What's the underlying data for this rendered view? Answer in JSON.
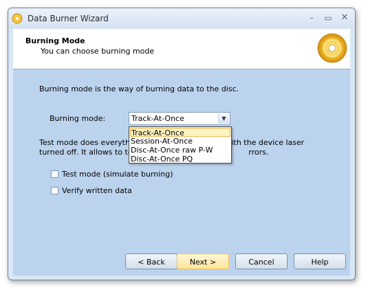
{
  "window": {
    "title": "Data Burner Wizard"
  },
  "header": {
    "title": "Burning Mode",
    "subtitle": "You can choose burning mode"
  },
  "content": {
    "description": "Burning mode is the way of burning data to the disc.",
    "mode_label": "Burning mode:",
    "mode_selected": "Track-At-Once",
    "test_text_line1": "Test mode does everything",
    "test_text_line1b": "out with the device laser",
    "test_text_line2": "turned off. It allows to tes",
    "test_text_line2b": "rrors.",
    "options": [
      "Track-At-Once",
      "Session-At-Once",
      "Disc-At-Once raw P-W",
      "Disc-At-Once PQ"
    ],
    "checkbox_test": "Test mode (simulate burning)",
    "checkbox_verify": "Verify written data"
  },
  "buttons": {
    "back": "< Back",
    "next": "Next >",
    "cancel": "Cancel",
    "help": "Help"
  }
}
